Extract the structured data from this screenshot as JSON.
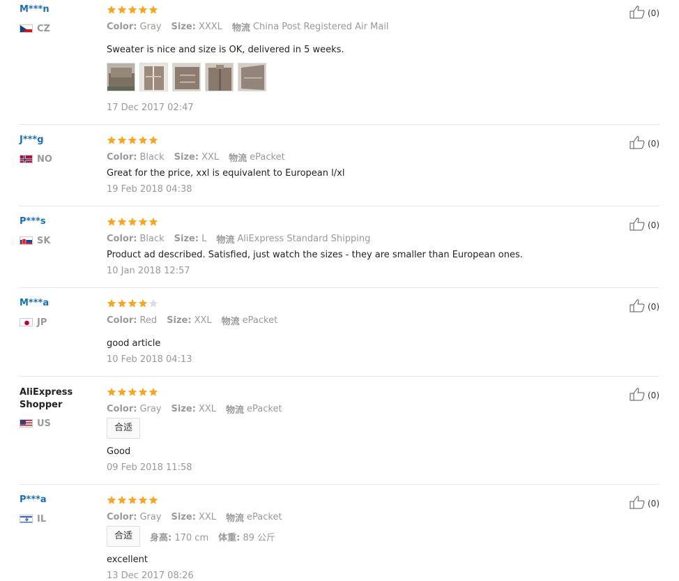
{
  "colors": {
    "star_full": "#f5a623",
    "star_empty": "#dddddd",
    "name_link": "#1a6fb5",
    "muted": "#999999"
  },
  "reviews": [
    {
      "user": "M***n",
      "country": "CZ",
      "flag": "cz-flag-icon",
      "rating": 5,
      "color_label": "Color:",
      "color": "Gray",
      "size_label": "Size:",
      "size": "XXXL",
      "shipping_label": "物流",
      "shipping": "China Post Registered Air Mail",
      "text": "Sweater is nice and size is OK, delivered in 5 weeks.",
      "photo_count": 5,
      "date": "17 Dec 2017 02:47",
      "helpful": "(0)"
    },
    {
      "user": "J***g",
      "country": "NO",
      "flag": "no-flag-icon",
      "rating": 5,
      "color_label": "Color:",
      "color": "Black",
      "size_label": "Size:",
      "size": "XXL",
      "shipping_label": "物流",
      "shipping": "ePacket",
      "text": "Great for the price, xxl is equivalent to European l/xl",
      "date": "19 Feb 2018 04:38",
      "helpful": "(0)"
    },
    {
      "user": "P***s",
      "country": "SK",
      "flag": "sk-flag-icon",
      "rating": 5,
      "color_label": "Color:",
      "color": "Black",
      "size_label": "Size:",
      "size": "L",
      "shipping_label": "物流",
      "shipping": "AliExpress Standard Shipping",
      "text": "Product ad described. Satisfied, just watch the sizes - they are smaller than European ones.",
      "date": "10 Jan 2018 12:57",
      "helpful": "(0)"
    },
    {
      "user": "M***a",
      "country": "JP",
      "flag": "jp-flag-icon",
      "rating": 4,
      "color_label": "Color:",
      "color": "Red",
      "size_label": "Size:",
      "size": "XXL",
      "shipping_label": "物流",
      "shipping": "ePacket",
      "text": "good article",
      "date": "10 Feb 2018 04:13",
      "helpful": "(0)"
    },
    {
      "user": "AliExpress Shopper",
      "country": "US",
      "flag": "us-flag-icon",
      "rating": 5,
      "color_label": "Color:",
      "color": "Gray",
      "size_label": "Size:",
      "size": "XXL",
      "shipping_label": "物流",
      "shipping": "ePacket",
      "tag": "合适",
      "text": "Good",
      "date": "09 Feb 2018 11:58",
      "helpful": "(0)"
    },
    {
      "user": "P***a",
      "country": "IL",
      "flag": "il-flag-icon",
      "rating": 5,
      "color_label": "Color:",
      "color": "Gray",
      "size_label": "Size:",
      "size": "XXL",
      "shipping_label": "物流",
      "shipping": "ePacket",
      "tag": "合适",
      "height_label": "身高:",
      "height": "170 cm",
      "weight_label": "体重:",
      "weight": "89 公斤",
      "text": "excellent",
      "date": "13 Dec 2017 08:26",
      "helpful": "(0)"
    }
  ]
}
